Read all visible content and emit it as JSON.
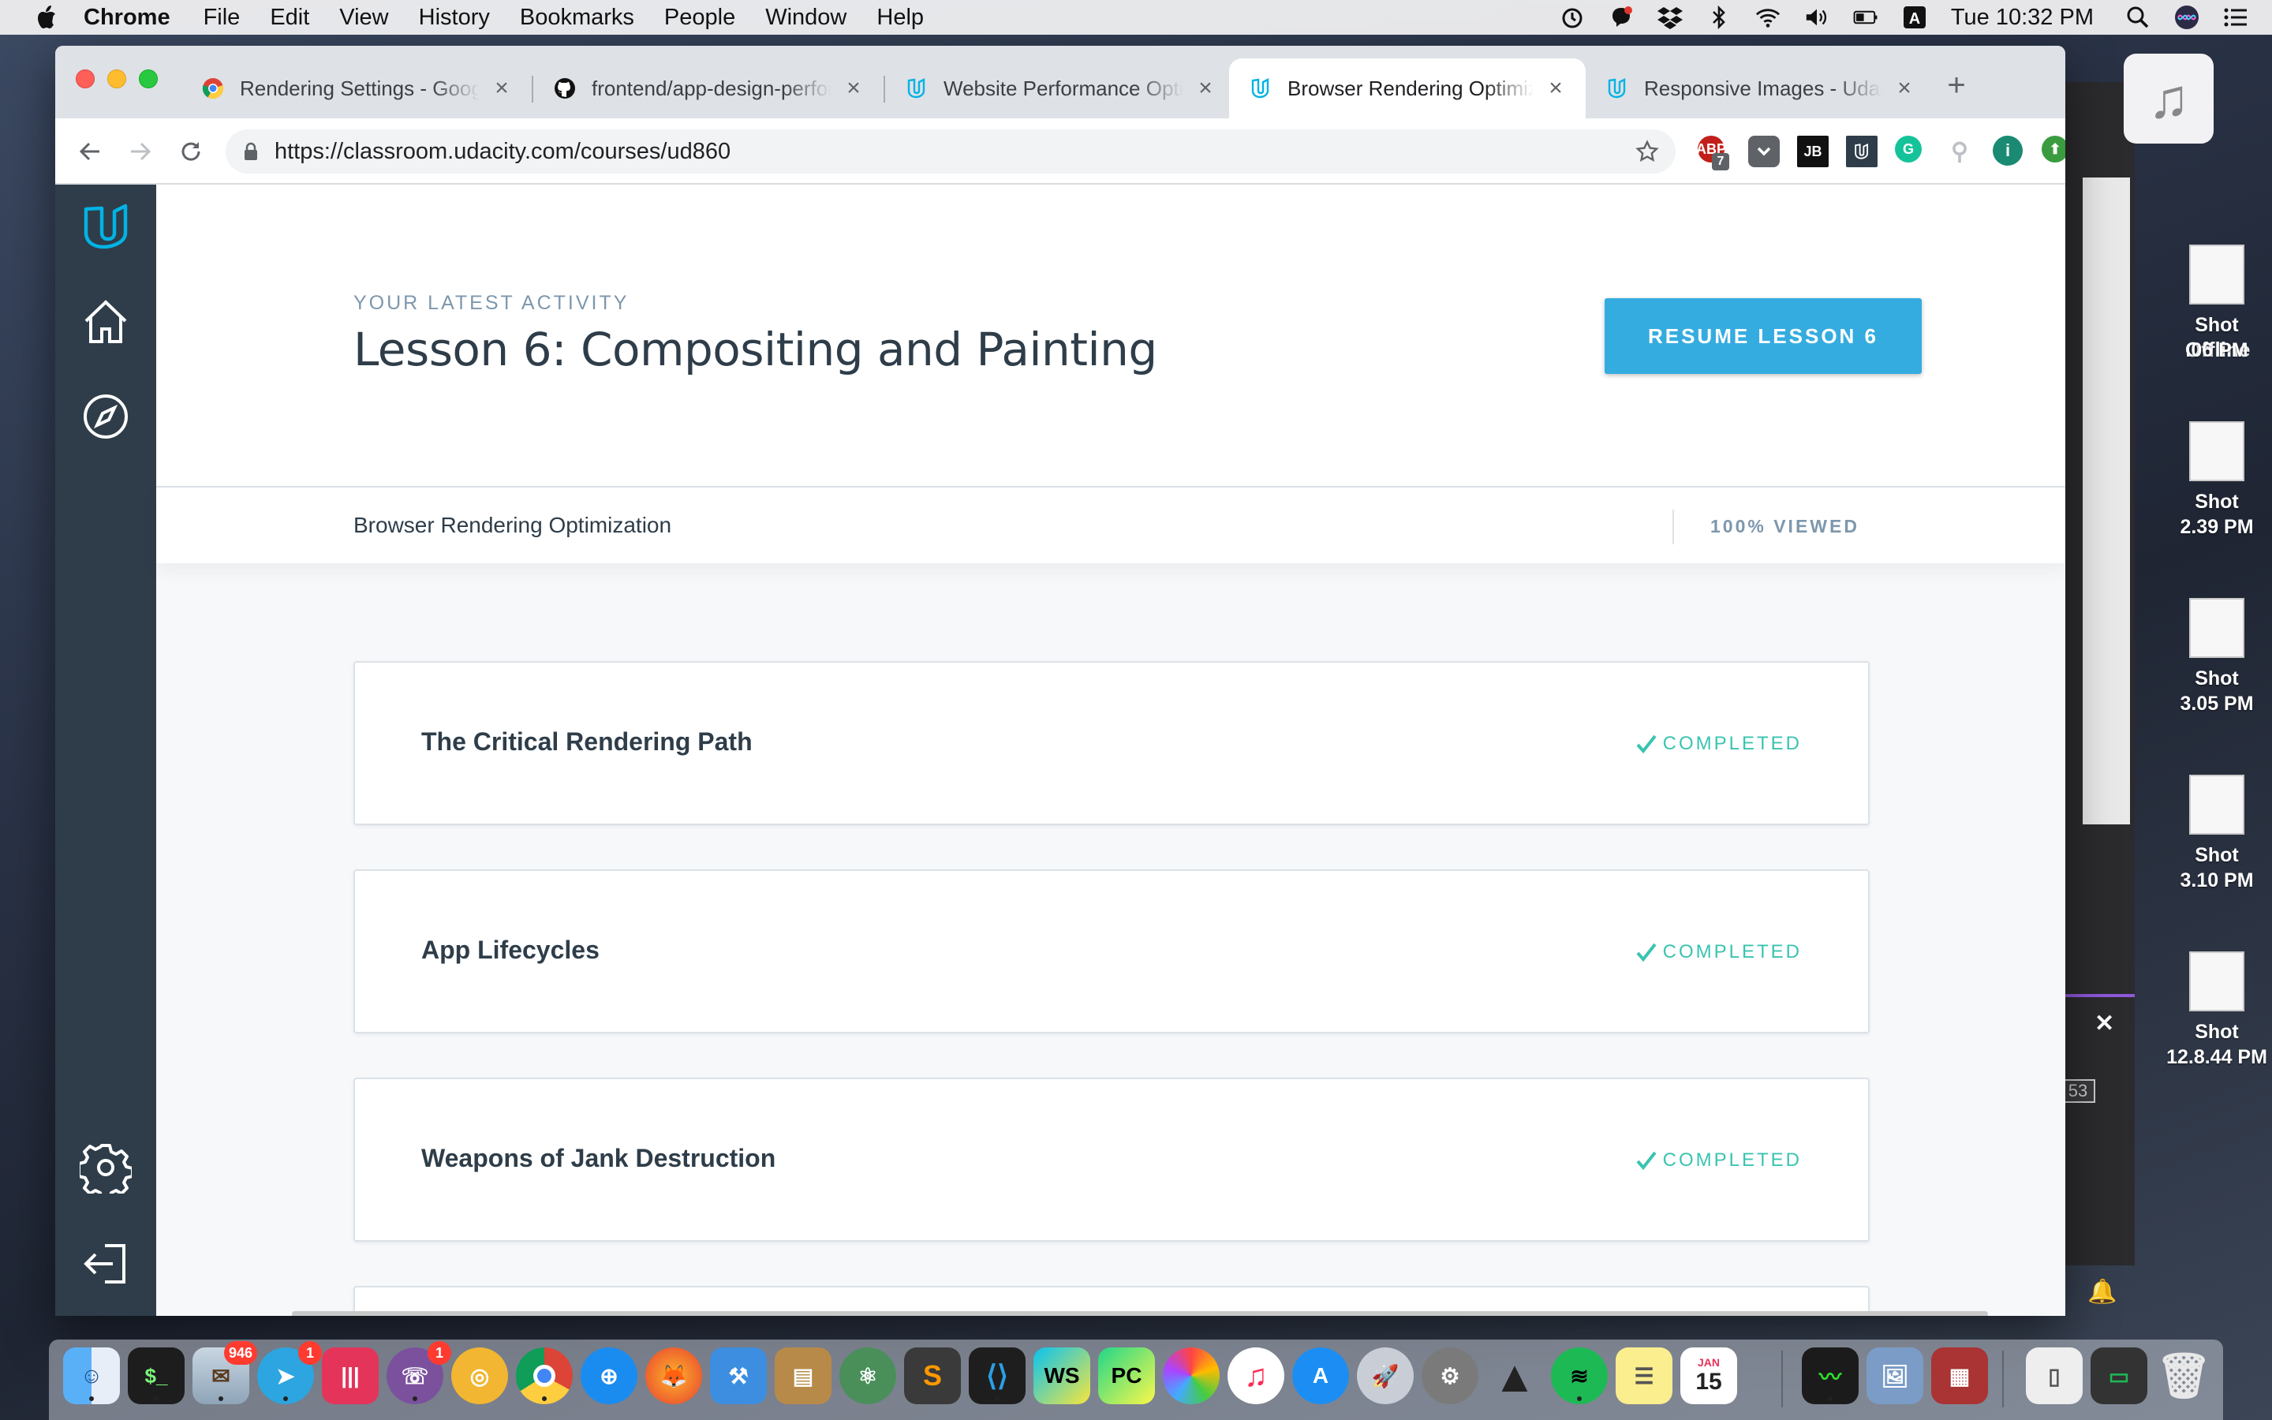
{
  "menubar": {
    "app_name": "Chrome",
    "items": [
      "File",
      "Edit",
      "View",
      "History",
      "Bookmarks",
      "People",
      "Window",
      "Help"
    ],
    "clock": "Tue 10:32 PM"
  },
  "tabs": [
    {
      "title": "Rendering Settings - Google",
      "icon": "chrome-icon"
    },
    {
      "title": "frontend/app-design-perfor",
      "icon": "github-icon"
    },
    {
      "title": "Website Performance Optim",
      "icon": "udacity-icon"
    },
    {
      "title": "Browser Rendering Optimiza",
      "icon": "udacity-icon",
      "active": true
    },
    {
      "title": "Responsive Images - Udacit",
      "icon": "udacity-icon"
    }
  ],
  "toolbar": {
    "url": "https://classroom.udacity.com/courses/ud860",
    "extensions": {
      "abp_badge": "7",
      "jb_label": "JB",
      "info_label": "i"
    }
  },
  "hero": {
    "label": "YOUR LATEST ACTIVITY",
    "title": "Lesson 6: Compositing and Painting",
    "resume_button": "RESUME LESSON 6"
  },
  "course": {
    "name": "Browser Rendering Optimization",
    "viewed": "100% VIEWED"
  },
  "lessons": [
    {
      "name": "The Critical Rendering Path",
      "status": "COMPLETED"
    },
    {
      "name": "App Lifecycles",
      "status": "COMPLETED"
    },
    {
      "name": "Weapons of Jank Destruction",
      "status": "COMPLETED"
    }
  ],
  "desktop": {
    "offline_label": "Offline",
    "files": [
      {
        "line1": "Shot",
        "line2": ".06 PM"
      },
      {
        "line1": "Shot",
        "line2": "2.39 PM"
      },
      {
        "line1": "Shot",
        "line2": "3.05 PM"
      },
      {
        "line1": "Shot",
        "line2": "3.10 PM"
      },
      {
        "line1": "Shot",
        "line2": "12.8.44 PM"
      }
    ],
    "badge": "53"
  },
  "dock": {
    "mail_badge": "946",
    "telegram_badge": "1",
    "viber_badge": "1",
    "calendar_month": "JAN",
    "calendar_day": "15",
    "webstorm_label": "WS",
    "pycharm_label": "PC"
  },
  "colors": {
    "udacity_dark": "#2e3d49",
    "udacity_blue": "#35ace0",
    "completed": "#3ac4b0"
  }
}
